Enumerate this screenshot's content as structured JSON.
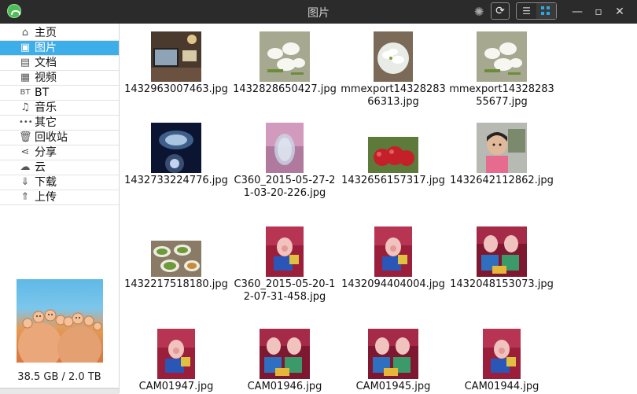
{
  "window": {
    "title": "图片"
  },
  "sidebar": {
    "items": [
      {
        "label": "主页",
        "icon": "home-icon",
        "glyph": "⌂"
      },
      {
        "label": "图片",
        "icon": "image-icon",
        "glyph": "▣"
      },
      {
        "label": "文档",
        "icon": "document-icon",
        "glyph": "▤"
      },
      {
        "label": "视频",
        "icon": "video-icon",
        "glyph": "▦"
      },
      {
        "label": "BT",
        "icon": "bt-icon",
        "glyph": "BT"
      },
      {
        "label": "音乐",
        "icon": "music-icon",
        "glyph": "♫"
      },
      {
        "label": "其它",
        "icon": "more-icon",
        "glyph": "•••"
      },
      {
        "label": "回收站",
        "icon": "trash-icon",
        "glyph": "🗑"
      },
      {
        "label": "分享",
        "icon": "share-icon",
        "glyph": "⋖"
      },
      {
        "label": "云",
        "icon": "cloud-icon",
        "glyph": "☁"
      },
      {
        "label": "下载",
        "icon": "download-icon",
        "glyph": "⇓"
      },
      {
        "label": "上传",
        "icon": "upload-icon",
        "glyph": "⇑"
      }
    ],
    "selected_index": 1,
    "storage": "38.5 GB / 2.0 TB"
  },
  "files": [
    {
      "name": "1432963007463.jpg",
      "thumb": "tv-room"
    },
    {
      "name": "1432828650427.jpg",
      "thumb": "white-flowers"
    },
    {
      "name": "mmexport1432828366313.jpg",
      "thumb": "flowers-bowl"
    },
    {
      "name": "mmexport1432828355677.jpg",
      "thumb": "white-flowers"
    },
    {
      "name": "1432733224776.jpg",
      "thumb": "night-table"
    },
    {
      "name": "C360_2015-05-27-21-03-20-226.jpg",
      "thumb": "glass-vase"
    },
    {
      "name": "1432656157317.jpg",
      "thumb": "red-fruit"
    },
    {
      "name": "1432642112862.jpg",
      "thumb": "child"
    },
    {
      "name": "1432217518180.jpg",
      "thumb": "food-table"
    },
    {
      "name": "C360_2015-05-20-12-07-31-458.jpg",
      "thumb": "pig-toy"
    },
    {
      "name": "1432094404004.jpg",
      "thumb": "pig-toy"
    },
    {
      "name": "1432048153073.jpg",
      "thumb": "pig-toys"
    },
    {
      "name": "CAM01947.jpg",
      "thumb": "pig-toy"
    },
    {
      "name": "CAM01946.jpg",
      "thumb": "pig-toys"
    },
    {
      "name": "CAM01945.jpg",
      "thumb": "pig-toys"
    },
    {
      "name": "CAM01944.jpg",
      "thumb": "pig-toy"
    }
  ],
  "colors": {
    "titlebar": "#2b2b2b",
    "accent": "#3daee9"
  }
}
